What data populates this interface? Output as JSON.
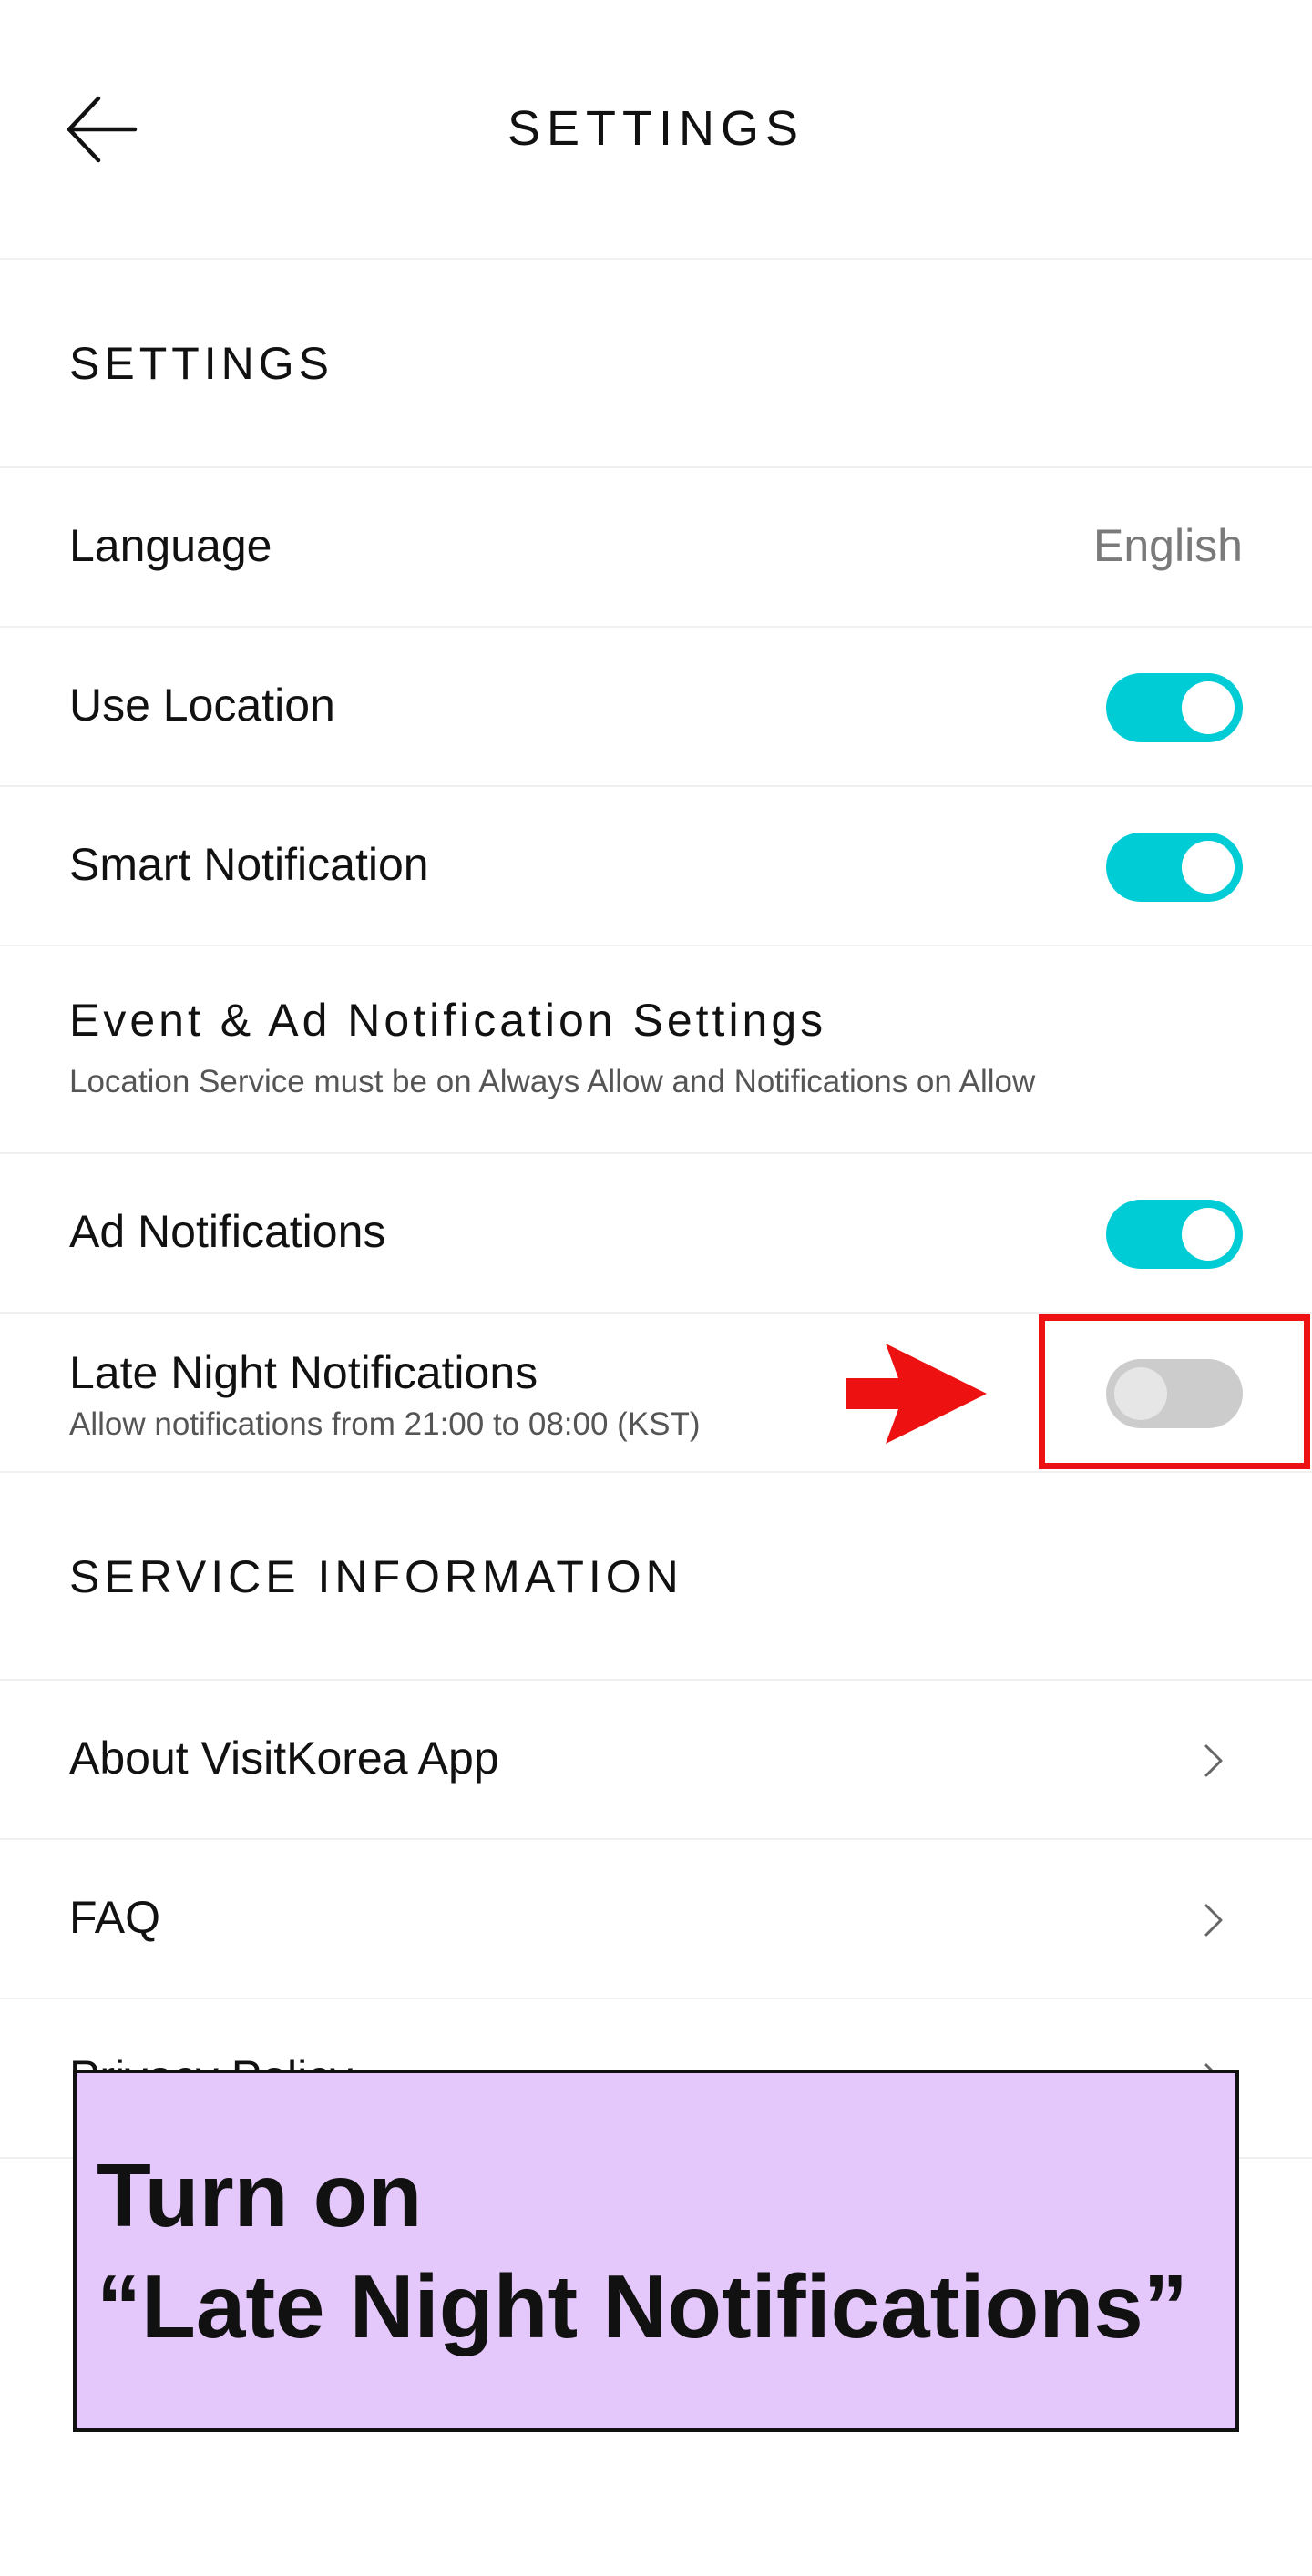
{
  "header": {
    "title": "SETTINGS",
    "back_icon": "arrow-left-icon"
  },
  "settings_section": {
    "heading": "SETTINGS",
    "language_label": "Language",
    "language_value": "English",
    "use_location_label": "Use Location",
    "use_location_on": true,
    "smart_notification_label": "Smart Notification",
    "smart_notification_on": true
  },
  "event_ad_section": {
    "heading": "Event & Ad Notification Settings",
    "description": "Location Service must be on Always Allow and Notifications on Allow",
    "ad_notifications_label": "Ad Notifications",
    "ad_notifications_on": true,
    "late_night_label": "Late Night Notifications",
    "late_night_description": "Allow notifications from 21:00 to 08:00 (KST)",
    "late_night_on": false
  },
  "service_section": {
    "heading": "SERVICE INFORMATION",
    "items": [
      {
        "label": "About VisitKorea App",
        "icon": "chevron-right-icon"
      },
      {
        "label": "FAQ",
        "icon": "chevron-right-icon"
      },
      {
        "label": "Privacy Policy",
        "icon": "chevron-right-icon"
      }
    ]
  },
  "overlay": {
    "caption_line1": "Turn on",
    "caption_line2": "“Late Night Notifications”",
    "highlight_color": "#ee1111",
    "caption_bg": "#e5c8fb"
  },
  "colors": {
    "toggle_on": "#00ccd6",
    "toggle_off": "#cccccc"
  }
}
